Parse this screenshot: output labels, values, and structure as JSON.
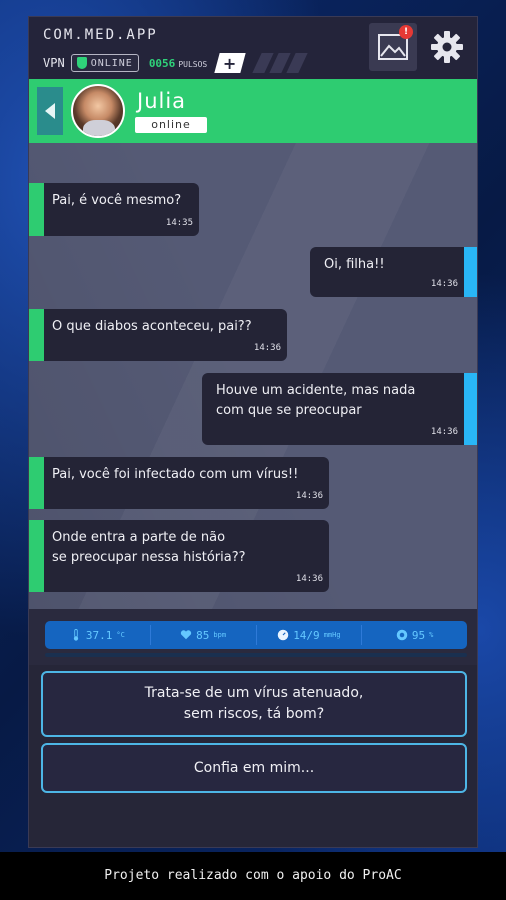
{
  "app": {
    "title": "COM.MED.APP"
  },
  "status": {
    "vpn_label": "VPN",
    "online_label": "ONLINE",
    "pulsos_value": "0056",
    "pulsos_label": "PULSOS",
    "plus_label": "+",
    "gallery_badge": "!"
  },
  "contact": {
    "name": "Julia",
    "status": "online"
  },
  "messages": [
    {
      "direction": "in",
      "text": "Pai, é você mesmo?",
      "time": "14:35"
    },
    {
      "direction": "out",
      "text": "Oi, filha!!",
      "time": "14:36"
    },
    {
      "direction": "in",
      "text": "O que diabos aconteceu, pai??",
      "time": "14:36"
    },
    {
      "direction": "out",
      "text": "Houve um acidente, mas nada\ncom que se preocupar",
      "time": "14:36"
    },
    {
      "direction": "in",
      "text": "Pai, você foi infectado com um vírus!!",
      "time": "14:36"
    },
    {
      "direction": "in",
      "text": "Onde entra a parte de não\nse preocupar nessa história??",
      "time": "14:36"
    }
  ],
  "vitals": {
    "temperature": "37.1",
    "temperature_unit": "°C",
    "heart_rate": "85",
    "heart_rate_unit": "bpm",
    "pressure": "14/9",
    "pressure_unit": "mmHg",
    "oxygen": "95",
    "oxygen_unit": "%"
  },
  "options": [
    {
      "text": "Trata-se de um vírus atenuado,\nsem riscos, tá bom?"
    },
    {
      "text": "Confia em mim..."
    }
  ],
  "footer": {
    "text": "Projeto realizado com o apoio do ProAC"
  },
  "colors": {
    "accent_green": "#2ecc71",
    "accent_blue": "#29b6f6",
    "bubble_bg": "#242436",
    "chat_bg": "#555a75",
    "vitals_bg": "#1565c0"
  },
  "icons": {
    "gallery": "image-icon",
    "settings": "gear-icon",
    "back": "back-arrow-icon",
    "shield": "shield-icon",
    "thermometer": "thermometer-icon",
    "heart": "heart-icon",
    "pressure": "gauge-icon",
    "oxygen": "oxygen-icon"
  }
}
